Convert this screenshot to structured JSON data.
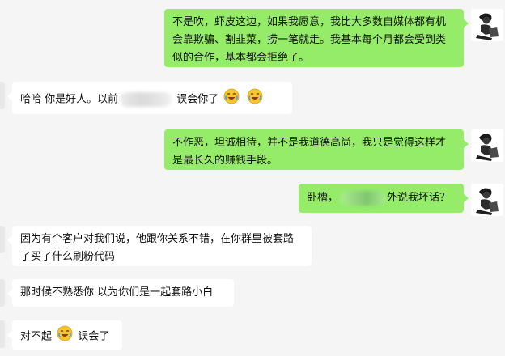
{
  "messages": [
    {
      "id": "m1",
      "side": "right",
      "text": "不是吹，虾皮这边，如果我愿意，我比大多数自媒体都有机会靠欺骗、割韭菜，捞一笔就走。我基本每个月都会受到类似的合作，基本都会拒绝了。"
    },
    {
      "id": "m2",
      "side": "left",
      "text_before": "哈哈 你是好人。以前",
      "redacted": true,
      "text_after": "误会你了",
      "emojis": [
        "laughing-tears-emoji",
        "laughing-tears-emoji"
      ]
    },
    {
      "id": "m3",
      "side": "right",
      "text": "不作恶，坦诚相待，并不是我道德高尚，我只是觉得这样才是最长久的赚钱手段。"
    },
    {
      "id": "m4",
      "side": "right",
      "text_before": "卧槽，",
      "redacted": true,
      "text_after": "外说我坏话？"
    },
    {
      "id": "m5",
      "side": "left",
      "text": "因为有个客户对我们说，他跟你关系不错，在你群里被套路了买了什么刷粉代码"
    },
    {
      "id": "m6",
      "side": "left",
      "text": "那时候不熟悉你 以为你们是一起套路小白"
    },
    {
      "id": "m7",
      "side": "left",
      "text_before": "对不起",
      "emojis": [
        "laughing-tears-emoji"
      ],
      "text_after": "误会了"
    }
  ],
  "colors": {
    "background": "#f5f5f5",
    "outgoing_bubble": "#95ec69",
    "incoming_bubble": "#ffffff"
  }
}
